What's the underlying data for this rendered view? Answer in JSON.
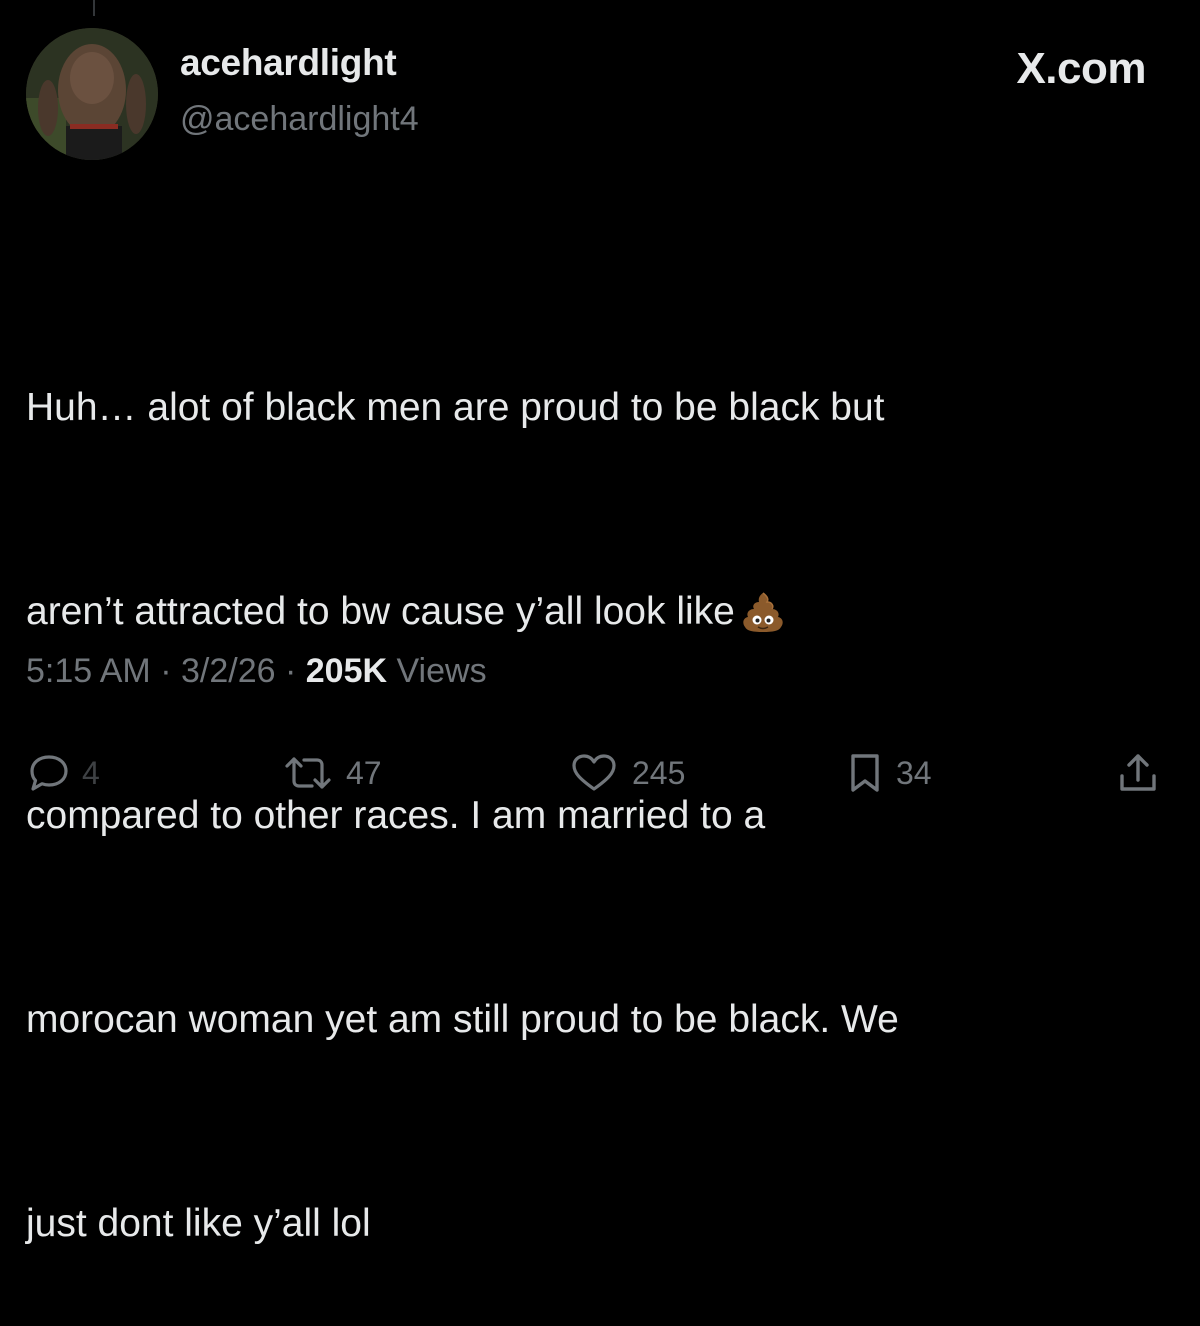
{
  "tweet": {
    "display_name": "acehardlight",
    "handle": "@acehardlight4",
    "brand": "X.com",
    "text_lines": [
      "Huh… alot of black men are proud to be black but",
      "aren’t attracted to bw cause y’all look like",
      "compared to other races. I am married to a",
      "morocan woman yet am still proud to be black. We",
      "just dont like y’all lol"
    ],
    "emoji": "pile-of-poo",
    "time": "5:15 AM",
    "date": "3/2/26",
    "separator": "·",
    "views_count": "205K",
    "views_label": "Views"
  },
  "actions": {
    "reply": {
      "icon": "reply-icon",
      "count": "4"
    },
    "repost": {
      "icon": "repost-icon",
      "count": "47"
    },
    "like": {
      "icon": "heart-icon",
      "count": "245"
    },
    "bookmark": {
      "icon": "bookmark-icon",
      "count": "34"
    },
    "share": {
      "icon": "share-icon"
    }
  },
  "colors": {
    "background": "#000000",
    "primary_text": "#e7e9ea",
    "secondary_text": "#71767b"
  }
}
